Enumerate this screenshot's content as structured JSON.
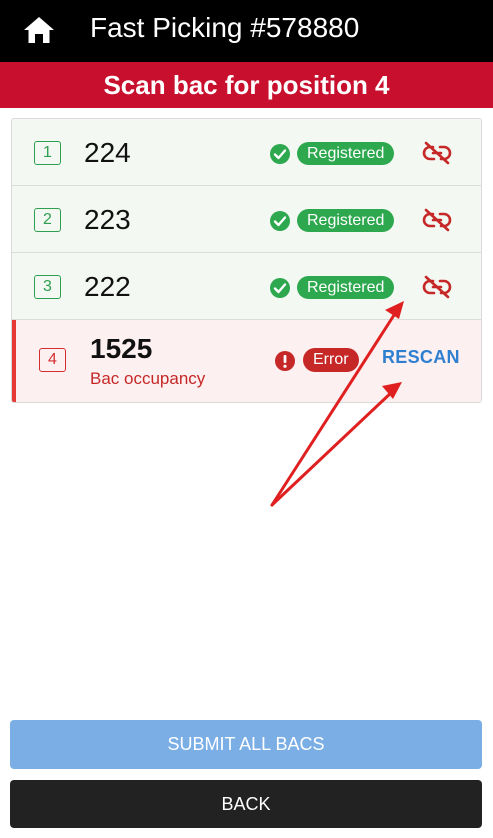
{
  "header": {
    "title": "Fast Picking #578880",
    "home_icon": "home-icon"
  },
  "banner": {
    "text": "Scan bac for position 4"
  },
  "bacs": [
    {
      "position": "1",
      "number": "224",
      "status": "Registered",
      "action_icon": "unlink-icon"
    },
    {
      "position": "2",
      "number": "223",
      "status": "Registered",
      "action_icon": "unlink-icon"
    },
    {
      "position": "3",
      "number": "222",
      "status": "Registered",
      "action_icon": "unlink-icon"
    },
    {
      "position": "4",
      "number": "1525",
      "reason": "Bac occupancy",
      "status": "Error",
      "action_label": "RESCAN"
    }
  ],
  "actions": {
    "submit_label": "SUBMIT ALL BACS",
    "back_label": "BACK"
  },
  "colors": {
    "header_bg": "#000000",
    "banner_bg": "#c8102e",
    "success": "#2ea84f",
    "error": "#c62828",
    "link": "#2f7fd1",
    "submit_bg": "#7aaee4",
    "back_bg": "#222222"
  }
}
